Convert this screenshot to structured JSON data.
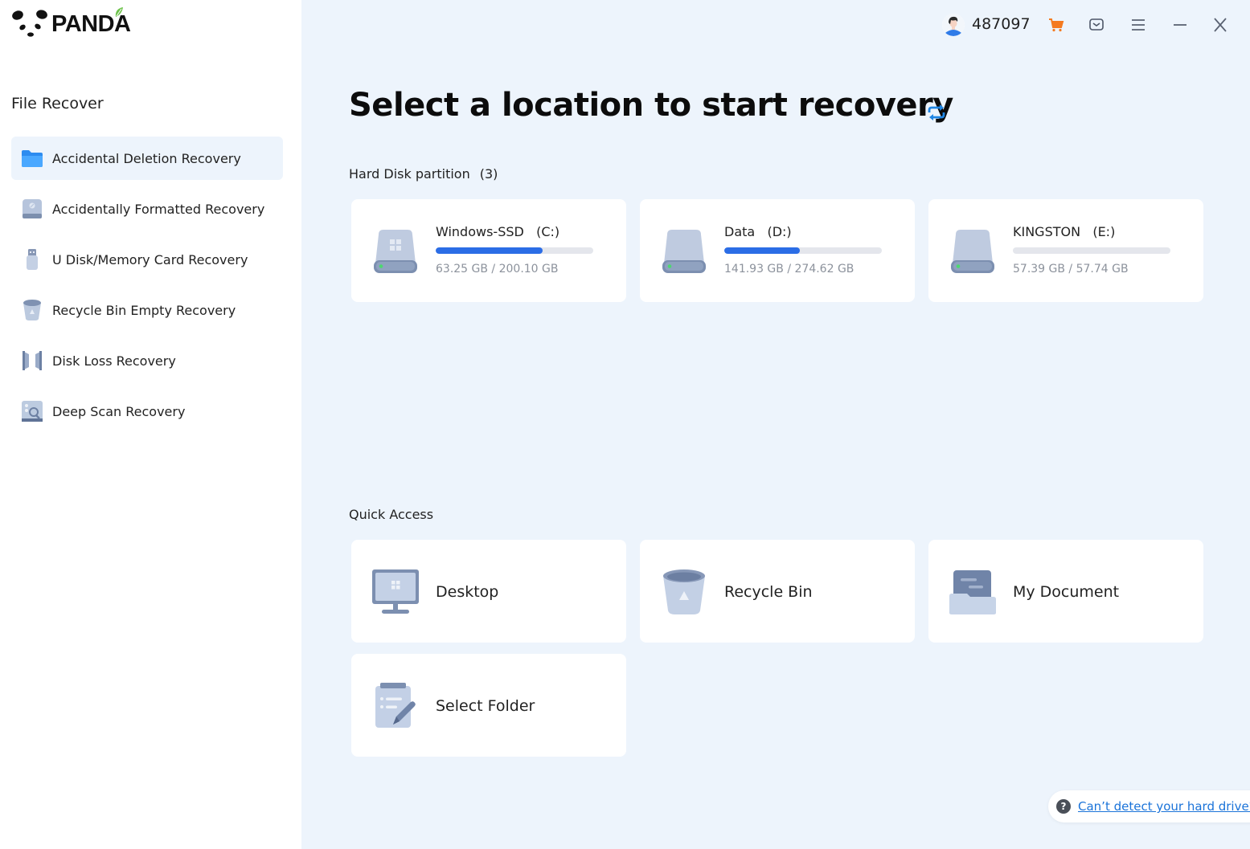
{
  "app": {
    "logo_text": "PANDA"
  },
  "header": {
    "user_id": "487097",
    "icons": [
      "user-avatar",
      "cart-icon",
      "message-icon",
      "menu-icon",
      "minimize-icon",
      "close-icon"
    ],
    "cart_color": "#f47a20"
  },
  "sidebar": {
    "section_title": "File Recover",
    "items": [
      {
        "label": "Accidental Deletion Recovery",
        "icon": "folder-icon",
        "active": true
      },
      {
        "label": "Accidentally Formatted Recovery",
        "icon": "formatted-drive-icon",
        "active": false
      },
      {
        "label": "U Disk/Memory Card Recovery",
        "icon": "usb-drive-icon",
        "active": false
      },
      {
        "label": "Recycle Bin Empty Recovery",
        "icon": "recycle-bin-icon",
        "active": false
      },
      {
        "label": "Disk Loss Recovery",
        "icon": "disk-loss-icon",
        "active": false
      },
      {
        "label": "Deep Scan Recovery",
        "icon": "deep-scan-icon",
        "active": false
      }
    ]
  },
  "main": {
    "title": "Select a location to start recovery",
    "hard_disk": {
      "label": "Hard Disk partition",
      "count": "(3)",
      "drives": [
        {
          "name": "Windows-SSD   (C:)",
          "size": "63.25 GB / 200.10 GB",
          "used_fraction": 0.68,
          "icon": "windows-drive-icon"
        },
        {
          "name": "Data   (D:)",
          "size": "141.93 GB / 274.62 GB",
          "used_fraction": 0.48,
          "icon": "drive-icon"
        },
        {
          "name": "KINGSTON   (E:)",
          "size": "57.39 GB / 57.74 GB",
          "used_fraction": 0.0,
          "icon": "drive-icon"
        }
      ]
    },
    "quick_access": {
      "label": "Quick Access",
      "items": [
        {
          "label": "Desktop",
          "icon": "desktop-icon"
        },
        {
          "label": "Recycle Bin",
          "icon": "recycle-bin-icon"
        },
        {
          "label": "My Document",
          "icon": "document-folder-icon"
        },
        {
          "label": "Select Folder",
          "icon": "select-folder-icon"
        }
      ]
    },
    "help_link": "Can’t detect your hard drive?"
  },
  "colors": {
    "accent": "#2b6de6",
    "background": "#edf4fc",
    "link": "#1a73d9"
  }
}
